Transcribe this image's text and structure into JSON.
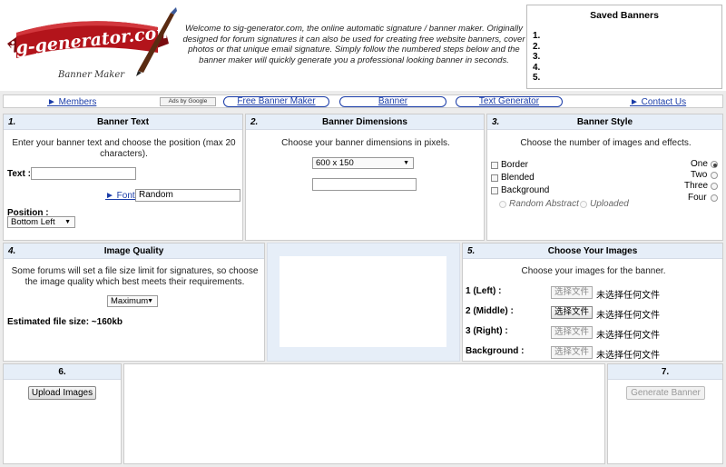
{
  "header": {
    "logo_text": "sig-generator.com",
    "logo_subtitle": "Banner Maker",
    "welcome": "Welcome to sig-generator.com, the online automatic signature / banner maker. Originally designed for forum signatures it can also be used for creating free website banners, cover photos or that unique email signature. Simply follow the numbered steps below and the banner maker will quickly generate you a professional looking banner in seconds."
  },
  "saved_banners": {
    "title": "Saved Banners",
    "items": [
      "1.",
      "2.",
      "3.",
      "4.",
      "5."
    ]
  },
  "nav": {
    "members": "► Members",
    "ads_by": "Ads by Google",
    "free_banner_maker": "Free Banner Maker",
    "banner": "Banner",
    "text_generator": "Text Generator",
    "contact_us": "► Contact Us"
  },
  "step1": {
    "num": "1.",
    "title": "Banner Text",
    "desc": "Enter your banner text and choose the position (max 20 characters).",
    "text_label": "Text :",
    "text_value": "",
    "font_link": "► Font:",
    "font_value": "Random",
    "position_label": "Position :",
    "position_value": "Bottom Left"
  },
  "step2": {
    "num": "2.",
    "title": "Banner Dimensions",
    "desc": "Choose your banner dimensions in pixels.",
    "dimension_value": "600 x 150",
    "custom_value": ""
  },
  "step3": {
    "num": "3.",
    "title": "Banner Style",
    "desc": "Choose the number of images and effects.",
    "effects": [
      "Border",
      "Blended",
      "Background"
    ],
    "bg_options": [
      "Random Abstract",
      "Uploaded"
    ],
    "counts": [
      "One",
      "Two",
      "Three",
      "Four"
    ],
    "selected_count": "One"
  },
  "step4": {
    "num": "4.",
    "title": "Image Quality",
    "desc": "Some forums will set a file size limit for signatures, so choose the image quality which best meets their requirements.",
    "quality_value": "Maximum",
    "file_size": "Estimated file size: ~160kb"
  },
  "step5": {
    "num": "5.",
    "title": "Choose Your Images",
    "desc": "Choose your images for the banner.",
    "rows": [
      {
        "label": "1 (Left) :",
        "button": "选择文件",
        "status": "未选择任何文件"
      },
      {
        "label": "2 (Middle) :",
        "button": "选择文件",
        "status": "未选择任何文件"
      },
      {
        "label": "3 (Right) :",
        "button": "选择文件",
        "status": "未选择任何文件"
      },
      {
        "label": "Background :",
        "button": "选择文件",
        "status": "未选择任何文件"
      }
    ]
  },
  "step6": {
    "num": "6.",
    "button": "Upload Images"
  },
  "step7": {
    "num": "7.",
    "button": "Generate Banner"
  },
  "colors": {
    "panel_header": "#e6eef8",
    "link": "#1a3ca8",
    "logo_ribbon": "#b3141b"
  }
}
